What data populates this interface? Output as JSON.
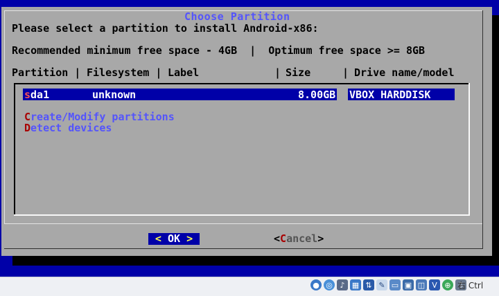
{
  "dialog": {
    "title": "Choose Partition",
    "prompt": "Please select a partition to install Android-x86:",
    "space_info": "Recommended minimum free space - 4GB  |  Optimum free space >= 8GB",
    "columns": {
      "partition": "Partition |",
      "filesystem": "Filesystem |",
      "label": "Label",
      "size_sep": "|",
      "size": "Size",
      "drive_sep": "|",
      "drive": "Drive name/model"
    },
    "partitions": [
      {
        "name_hotkey": "s",
        "name_rest": "da1",
        "filesystem": "unknown",
        "size": "8.00GB",
        "drive": "VBOX HARDDISK"
      }
    ],
    "menu_items": [
      {
        "hotkey": "C",
        "rest": "reate/Modify partitions"
      },
      {
        "hotkey": "D",
        "rest": "etect devices"
      }
    ],
    "buttons": {
      "ok_left": "<",
      "ok_label": " OK ",
      "ok_right": ">",
      "cancel_left": "<",
      "cancel_hotkey": "C",
      "cancel_rest": "ancel",
      "cancel_right": ">"
    }
  },
  "statusbar": {
    "icons": [
      "hdd-icon",
      "cd-icon",
      "audio-icon",
      "network-icon",
      "usb-icon",
      "shared-folder-icon",
      "display-icon",
      "recording-icon",
      "cpu-icon",
      "vbox-icon",
      "mouse-icon",
      "keyboard-icon"
    ],
    "host_key": "右 Ctrl"
  },
  "colors": {
    "background": "#0000a8",
    "dialog": "#a8a8a8",
    "title": "#5454fc",
    "selection": "#0000a8",
    "hotkey": "#a80000"
  }
}
